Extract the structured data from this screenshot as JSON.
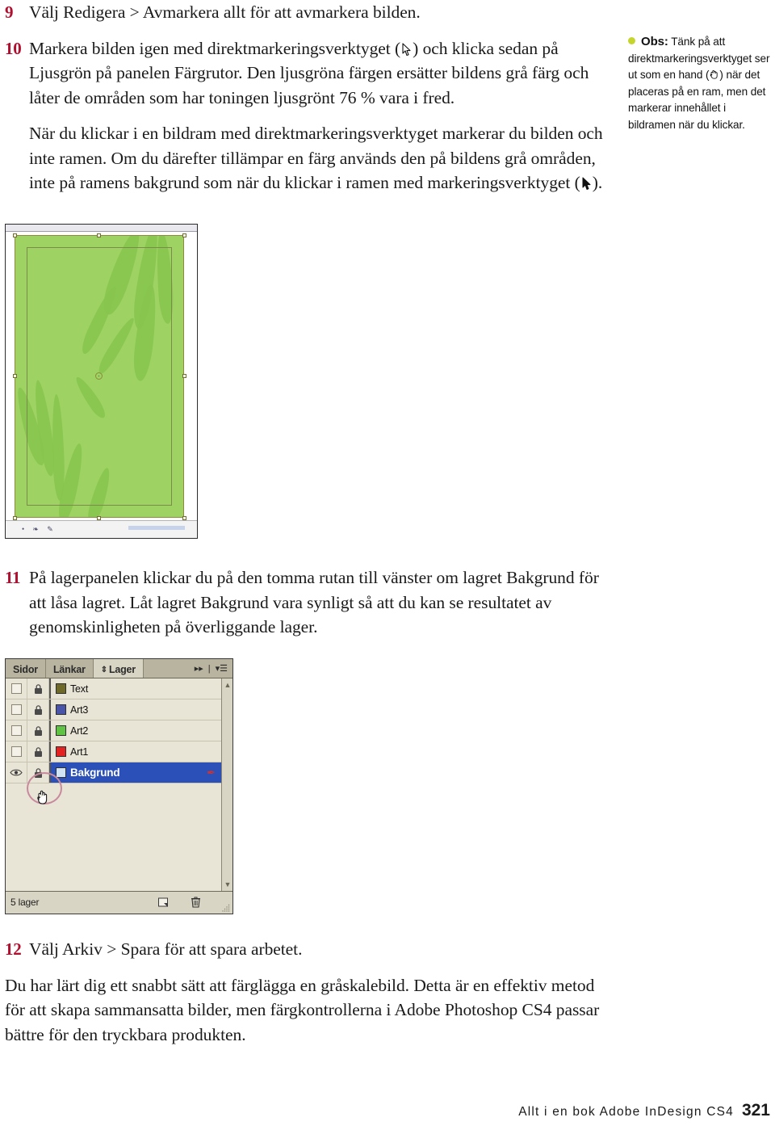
{
  "steps": [
    {
      "number": "9",
      "text": "Välj Redigera > Avmarkera allt för att avmarkera bilden."
    },
    {
      "number": "10",
      "text_before_icon": "Markera bilden igen med direktmarkeringsverktyget (",
      "icon": "direct-selection-tool-icon",
      "text_after_icon": ") och klicka sedan på Ljusgrön på panelen Färgrutor. Den ljusgröna färgen ersätter bildens grå färg och låter de områden som har toningen ljusgrönt 76 % vara i fred."
    },
    {
      "number": "11",
      "text": "På lagerpanelen klickar du på den tomma rutan till vänster om lagret Bakgrund för att låsa lagret. Låt lagret Bakgrund vara synligt så att du kan se resultatet av genomskinligheten på överliggande lager."
    },
    {
      "number": "12",
      "text": "Välj Arkiv > Spara för att spara arbetet."
    }
  ],
  "paragraph_after_step10": {
    "text_before_icon": "När du klickar i en bildram med direktmarkeringsverktyget markerar du bilden och inte ramen. Om du därefter tillämpar en färg används den på bildens grå områden, inte på ramens bakgrund som när du klickar i ramen med markeringsverktyget (",
    "icon": "selection-tool-icon",
    "text_after_icon": ")."
  },
  "closing_paragraph": {
    "text": "Du har lärt dig ett snabbt sätt att färglägga en gråskalebild. Detta är en effektiv metod för att skapa sammansatta bilder, men färgkontrollerna i Adobe Photoshop CS4 passar bättre för den tryckbara produkten."
  },
  "side_note": {
    "bullet_color": "#c6d42e",
    "label": "Obs:",
    "text_before_icon": " Tänk på att direktmarkeringsverktyget ser ut som en hand (",
    "icon": "hand-cursor-icon",
    "text_after_icon": ") när det placeras på en ram, men det markerar innehållet i bildramen när du klickar."
  },
  "document_screenshot": {
    "name": "indesign-document-window",
    "page_fill_color": "#9ed363",
    "leaf_color": "#86c44e",
    "frame_border_color": "#8d8a3c"
  },
  "layers_panel": {
    "tabs": [
      {
        "label": "Sidor",
        "active": false
      },
      {
        "label": "Länkar",
        "active": false
      },
      {
        "label": "Lager",
        "active": true
      }
    ],
    "collapse_icon": "double-arrow-right-icon",
    "menu_icon": "panel-menu-icon",
    "layers": [
      {
        "name": "Text",
        "swatch": "#6f6a2a",
        "visible": false,
        "locked": false,
        "selected": false,
        "pen": false
      },
      {
        "name": "Art3",
        "swatch": "#4a55aa",
        "visible": false,
        "locked": false,
        "selected": false,
        "pen": false
      },
      {
        "name": "Art2",
        "swatch": "#61c343",
        "visible": false,
        "locked": false,
        "selected": false,
        "pen": false
      },
      {
        "name": "Art1",
        "swatch": "#e32222",
        "visible": false,
        "locked": false,
        "selected": false,
        "pen": false
      },
      {
        "name": "Bakgrund",
        "swatch": "#cfe3f5",
        "visible": true,
        "locked": false,
        "selected": true,
        "pen": true
      }
    ],
    "footer": {
      "count_label": "5 lager",
      "new_layer_icon": "new-layer-icon",
      "delete_icon": "trash-icon",
      "resize_icon": "resize-grip-icon"
    },
    "highlight_color": "#c9899c",
    "selected_row_color": "#2b50b8"
  },
  "footer": {
    "book_title": "Allt i en bok Adobe InDesign CS4",
    "page_number": "321"
  }
}
